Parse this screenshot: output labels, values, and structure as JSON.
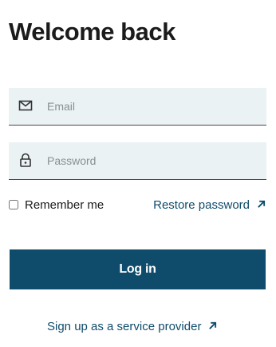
{
  "page": {
    "title": "Welcome back"
  },
  "form": {
    "email": {
      "placeholder": "Email",
      "value": "",
      "icon": "mail-icon"
    },
    "password": {
      "placeholder": "Password",
      "value": "",
      "icon": "lock-icon"
    },
    "remember": {
      "label": "Remember me",
      "checked": false
    },
    "restore_link": {
      "label": "Restore password",
      "icon": "external-arrow-icon"
    },
    "submit": {
      "label": "Log in"
    },
    "signup_link": {
      "label": "Sign up as a service provider",
      "icon": "external-arrow-icon"
    }
  },
  "colors": {
    "accent": "#0f4c6b",
    "field_background": "#eaf2f4",
    "text": "#1b1b1b",
    "placeholder": "#8a8f92"
  }
}
